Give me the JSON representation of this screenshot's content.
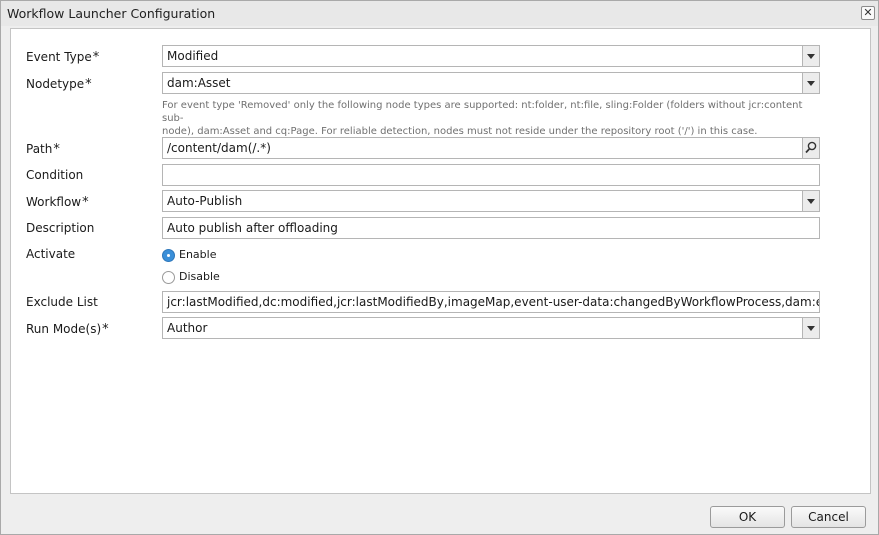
{
  "dialog": {
    "title": "Workflow Launcher Configuration",
    "close_glyph": "✕"
  },
  "form": {
    "event_type": {
      "label": "Event Type",
      "required_mark": "*",
      "value": "Modified"
    },
    "nodetype": {
      "label": "Nodetype",
      "required_mark": "*",
      "value": "dam:Asset",
      "hint_line1": "For event type 'Removed' only the following node types are supported: nt:folder, nt:file, sling:Folder (folders without jcr:content sub-",
      "hint_line2": "node), dam:Asset and cq:Page. For reliable detection, nodes must not reside under the repository root ('/') in this case."
    },
    "path": {
      "label": "Path",
      "required_mark": "*",
      "value": "/content/dam(/.*)"
    },
    "condition": {
      "label": "Condition",
      "value": ""
    },
    "workflow": {
      "label": "Workflow",
      "required_mark": "*",
      "value": "Auto-Publish"
    },
    "description": {
      "label": "Description",
      "value": "Auto publish after offloading"
    },
    "activate": {
      "label": "Activate",
      "options": [
        {
          "label": "Enable",
          "checked": true
        },
        {
          "label": "Disable",
          "checked": false
        }
      ]
    },
    "exclude_list": {
      "label": "Exclude List",
      "value": "jcr:lastModified,dc:modified,jcr:lastModifiedBy,imageMap,event-user-data:changedByWorkflowProcess,dam:extracted,simse"
    },
    "run_modes": {
      "label": "Run Mode(s)",
      "required_mark": "*",
      "value": "Author"
    }
  },
  "buttons": {
    "ok": "OK",
    "cancel": "Cancel"
  },
  "colors": {
    "radio_checked": "#3a8fd9",
    "panel_bg": "#ffffff",
    "dialog_bg": "#eeeeee"
  },
  "icons": {
    "dropdown": "chevron-down-icon",
    "search": "search-icon",
    "close": "close-icon"
  }
}
